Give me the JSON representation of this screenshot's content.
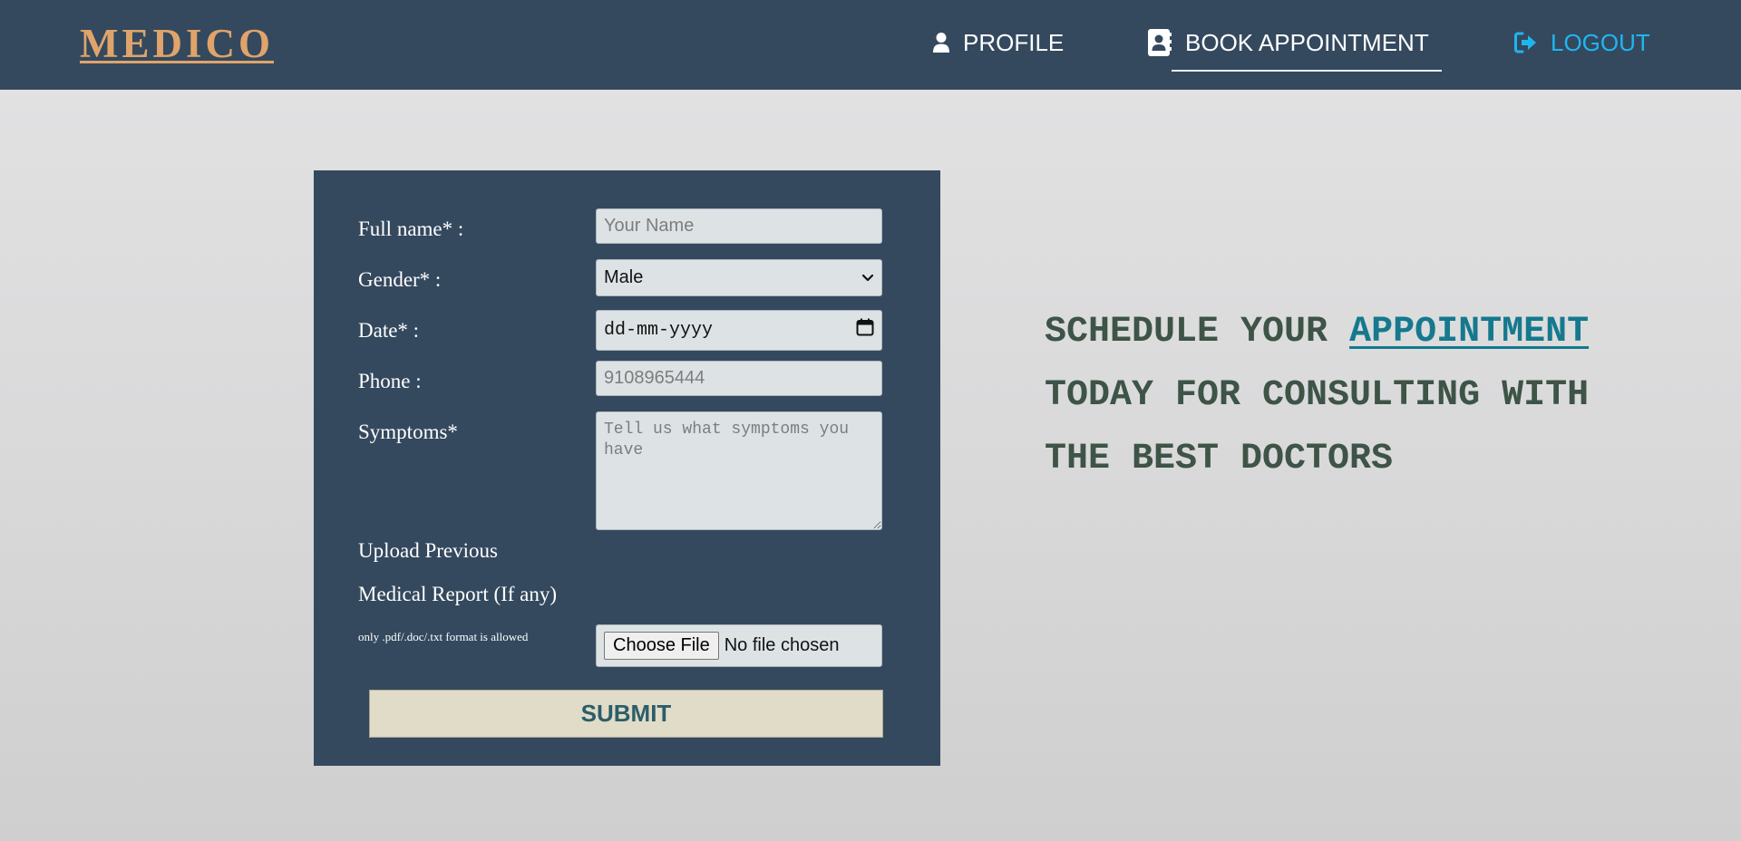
{
  "brand": {
    "name": "MEDICO",
    "color": "#e0a46a"
  },
  "nav": {
    "items": [
      {
        "label": "PROFILE",
        "icon": "user-icon"
      },
      {
        "label": "BOOK APPOINTMENT",
        "icon": "address-book-icon",
        "active": true
      },
      {
        "label": "LOGOUT",
        "icon": "sign-out-icon",
        "color": "#1fb6f0"
      }
    ],
    "background": "#34495e"
  },
  "form": {
    "full_name_label": "Full name* :",
    "full_name_placeholder": "Your Name",
    "gender_label": "Gender* :",
    "gender_value": "Male",
    "date_label": "Date* :",
    "date_placeholder": "dd-mm-yyyy",
    "phone_label": "Phone :",
    "phone_placeholder": "9108965444",
    "symptoms_label": "Symptoms*",
    "symptoms_placeholder": "Tell us what symptoms you have",
    "upload_label_line1": "Upload Previous",
    "upload_label_line2": "Medical Report (If any)",
    "upload_note": "only .pdf/.doc/.txt format is allowed",
    "file_button": "Choose File",
    "file_status": "No file chosen",
    "submit_label": "SUBMIT"
  },
  "tagline": {
    "line1_prefix": "SCHEDULE YOUR ",
    "line1_highlight": "APPOINTMENT",
    "line2": "TODAY FOR CONSULTING WITH",
    "line3": "THE BEST DOCTORS",
    "highlight_color": "#15798e"
  }
}
